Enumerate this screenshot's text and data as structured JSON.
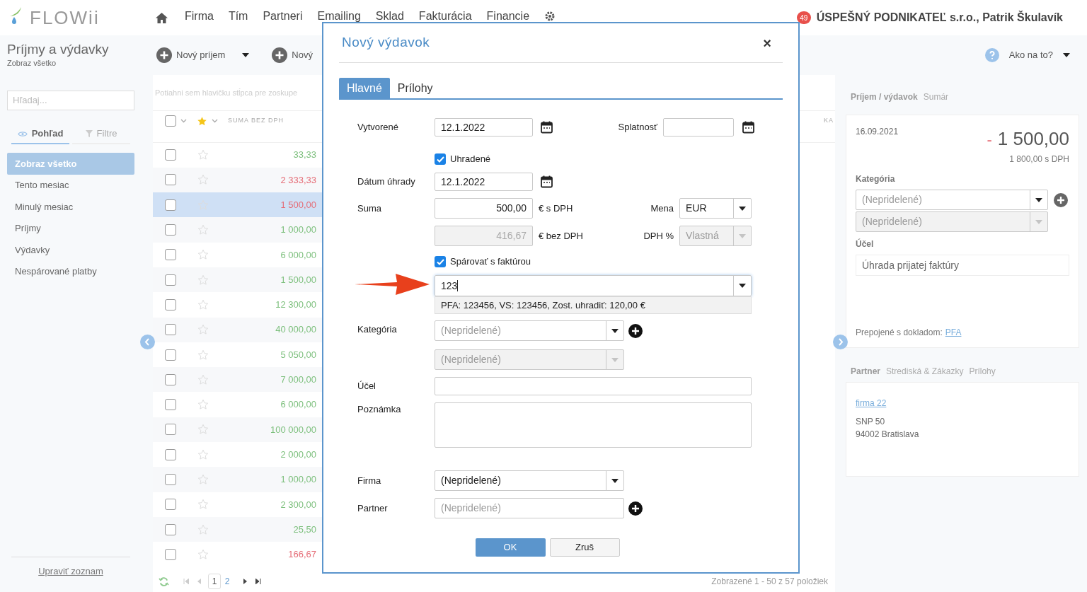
{
  "header": {
    "logo": "FLOWii",
    "nav": [
      "Firma",
      "Tím",
      "Partneri",
      "Emailing",
      "Sklad",
      "Fakturácia",
      "Financie"
    ],
    "notifications": "49",
    "account": "ÚSPEŠNÝ PODNIKATEĽ s.r.o., Patrik Škulavík"
  },
  "toolbar": {
    "title": "Príjmy a výdavky",
    "subtitle": "Zobraz všetko",
    "new_income": "Nový príjem",
    "new_expense": "Nový",
    "help": "Ako na to?"
  },
  "sidebar": {
    "search": {
      "placeholder": "Hľadaj..."
    },
    "tabs": [
      {
        "label": "Pohľad",
        "selected": true
      },
      {
        "label": "Filtre",
        "selected": false
      }
    ],
    "items": [
      {
        "label": "Zobraz všetko",
        "selected": true
      },
      {
        "label": "Tento mesiac",
        "selected": false
      },
      {
        "label": "Minulý mesiac",
        "selected": false
      },
      {
        "label": "Príjmy",
        "selected": false
      },
      {
        "label": "Výdavky",
        "selected": false
      },
      {
        "label": "Nespárované platby",
        "selected": false
      }
    ],
    "edit_link": "Upraviť zoznam"
  },
  "list": {
    "group_hint": "Potiahni sem hlavičku stĺpca pre zoskupe",
    "columns": [
      "SUMA BEZ DPH",
      "KA"
    ],
    "select_all": {
      "checked": false
    },
    "rows": [
      {
        "amount": "33,33",
        "kind": "income",
        "selected": false,
        "checked": false,
        "starred": false
      },
      {
        "amount": "2 333,33",
        "kind": "expense",
        "selected": false,
        "checked": false,
        "starred": false
      },
      {
        "amount": "1 500,00",
        "kind": "expense",
        "selected": true,
        "checked": false,
        "starred": false
      },
      {
        "amount": "1 000,00",
        "kind": "income",
        "selected": false,
        "checked": false,
        "starred": false
      },
      {
        "amount": "6 000,00",
        "kind": "income",
        "selected": false,
        "checked": false,
        "starred": false
      },
      {
        "amount": "1 500,00",
        "kind": "income",
        "selected": false,
        "checked": false,
        "starred": false
      },
      {
        "amount": "12 300,00",
        "kind": "income",
        "selected": false,
        "checked": false,
        "starred": false
      },
      {
        "amount": "40 000,00",
        "kind": "income",
        "selected": false,
        "checked": false,
        "starred": false
      },
      {
        "amount": "5 050,00",
        "kind": "income",
        "selected": false,
        "checked": false,
        "starred": false
      },
      {
        "amount": "7 000,00",
        "kind": "income",
        "selected": false,
        "checked": false,
        "starred": false
      },
      {
        "amount": "6 000,00",
        "kind": "income",
        "selected": false,
        "checked": false,
        "starred": false
      },
      {
        "amount": "100 000,00",
        "kind": "income",
        "selected": false,
        "checked": false,
        "starred": false
      },
      {
        "amount": "2 000,00",
        "kind": "income",
        "selected": false,
        "checked": false,
        "starred": false
      },
      {
        "amount": "1 000,00",
        "kind": "income",
        "selected": false,
        "checked": false,
        "starred": false
      },
      {
        "amount": "2 300,00",
        "kind": "income",
        "selected": false,
        "checked": false,
        "starred": false
      },
      {
        "amount": "25,50",
        "kind": "income",
        "selected": false,
        "checked": false,
        "starred": false
      },
      {
        "amount": "166,67",
        "kind": "expense",
        "selected": false,
        "checked": false,
        "starred": false
      }
    ],
    "pages": [
      {
        "label": "1",
        "selected": true
      },
      {
        "label": "2",
        "selected": false
      }
    ],
    "summary": "Zobrazené 1 - 50 z 57 položiek"
  },
  "detail": {
    "tabs": [
      {
        "label": "Príjem / výdavok",
        "selected": true
      },
      {
        "label": "Sumár",
        "selected": false
      }
    ],
    "date": "16.09.2021",
    "sign": "-",
    "amount": "1 500,00",
    "amount_vat": "1 800,00 s DPH",
    "category_label": "Kategória",
    "category": {
      "placeholder": "(Nepridelené)"
    },
    "subcategory": {
      "placeholder": "(Nepridelené)"
    },
    "purpose_label": "Účel",
    "purpose": "Úhrada prijatej faktúry",
    "linked_label": "Prepojené s dokladom:",
    "linked": "PFA",
    "partner_tabs": [
      {
        "label": "Partner",
        "selected": true
      },
      {
        "label": "Strediská & Zákazky",
        "selected": false
      },
      {
        "label": "Prílohy",
        "selected": false
      }
    ],
    "partner_name": "firma 22",
    "address": [
      "SNP 50",
      "94002 Bratislava"
    ]
  },
  "dialog": {
    "title": "Nový výdavok",
    "close": "×",
    "tabs": [
      {
        "label": "Hlavné",
        "selected": true
      },
      {
        "label": "Prílohy",
        "selected": false
      }
    ],
    "created": {
      "label": "Vytvorené",
      "value": "12.1.2022"
    },
    "due": {
      "label": "Splatnosť"
    },
    "paid": {
      "label": "Uhradené",
      "checked": true
    },
    "paid_date": {
      "label": "Dátum úhrady",
      "value": "12.1.2022"
    },
    "amount": {
      "label": "Suma",
      "value": "500,00",
      "unit": "€ s DPH",
      "disabled": false
    },
    "amount_net": {
      "value": "416,67",
      "unit": "€ bez DPH",
      "disabled": true
    },
    "currency": {
      "label": "Mena",
      "value": "EUR",
      "disabled": false
    },
    "vat": {
      "label": "DPH %",
      "value": "Vlastná",
      "disabled": true
    },
    "pair": {
      "label": "Spárovať s faktúrou",
      "checked": true
    },
    "invoice": {
      "value": "123",
      "suggestion": "PFA: 123456, VS: 123456, Zost. uhradiť: 120,00 €"
    },
    "category": {
      "label": "Kategória",
      "placeholder": "(Nepridelené)",
      "disabled": false
    },
    "subcategory": {
      "placeholder": "(Nepridelené)",
      "disabled": true
    },
    "purpose": {
      "label": "Účel"
    },
    "note": {
      "label": "Poznámka"
    },
    "company": {
      "label": "Firma",
      "value": "(Nepridelené)"
    },
    "partner": {
      "label": "Partner",
      "placeholder": "(Nepridelené)"
    },
    "buttons": [
      {
        "label": "OK",
        "kind": "primary"
      },
      {
        "label": "Zruš",
        "kind": "secondary"
      }
    ]
  }
}
